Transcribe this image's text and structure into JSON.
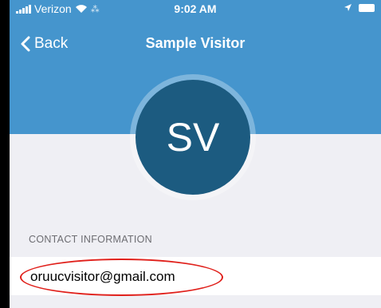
{
  "status_bar": {
    "carrier": "Verizon",
    "time": "9:02 AM",
    "icons": [
      "signal-icon",
      "wifi-icon",
      "activity-icon",
      "location-icon",
      "battery-icon"
    ]
  },
  "nav": {
    "back_label": "Back",
    "title": "Sample Visitor"
  },
  "avatar": {
    "initials": "SV"
  },
  "contact": {
    "section_header": "CONTACT INFORMATION",
    "email": "oruucvisitor@gmail.com"
  },
  "colors": {
    "header_bg": "#4595cd",
    "avatar_bg": "#1c5b80",
    "page_bg": "#efeff4",
    "annotation": "#e0201b"
  }
}
